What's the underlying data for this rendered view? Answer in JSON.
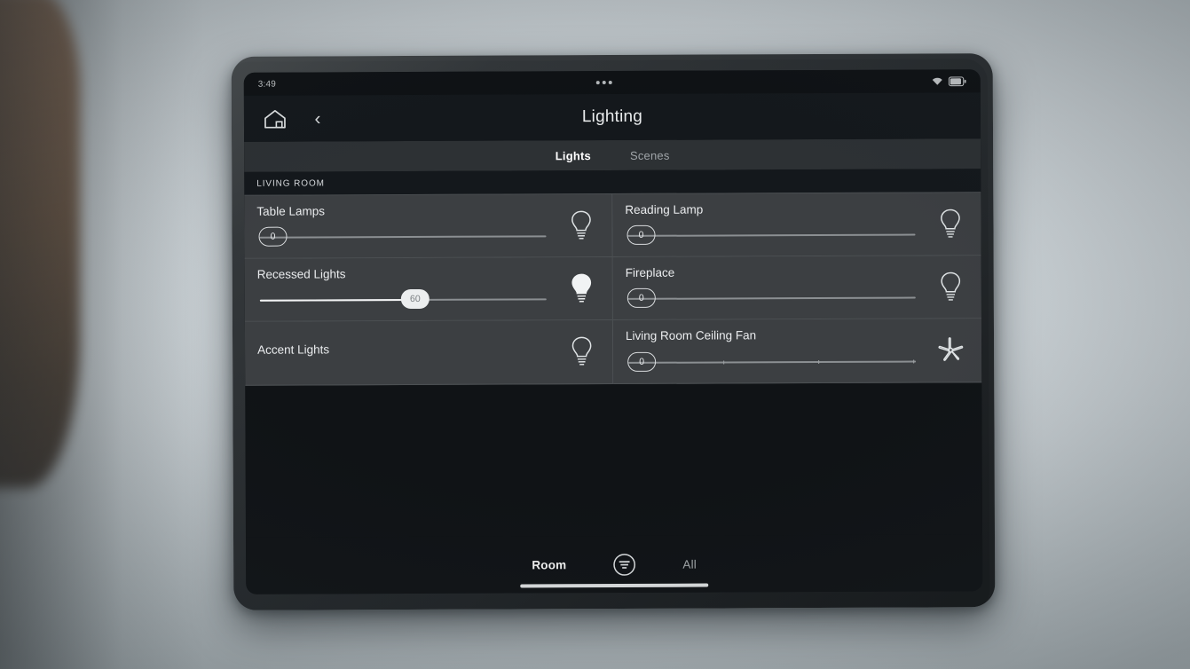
{
  "status_bar": {
    "time": "3:49",
    "center_icon": "more-dots-icon",
    "wifi_icon": "wifi-icon",
    "battery_icon": "battery-icon"
  },
  "header": {
    "home_icon": "home-icon",
    "back_icon": "back-chevron-icon",
    "title": "Lighting"
  },
  "tabs": [
    {
      "label": "Lights",
      "active": true
    },
    {
      "label": "Scenes",
      "active": false
    }
  ],
  "section": {
    "label": "LIVING ROOM"
  },
  "devices": [
    {
      "name": "Table Lamps",
      "has_slider": true,
      "value": "0",
      "value_pct": 0,
      "ticks": false,
      "icon": "bulb-outline-icon",
      "on": false
    },
    {
      "name": "Reading Lamp",
      "has_slider": true,
      "value": "0",
      "value_pct": 0,
      "ticks": false,
      "icon": "bulb-outline-icon",
      "on": false
    },
    {
      "name": "Recessed Lights",
      "has_slider": true,
      "value": "60",
      "value_pct": 60,
      "ticks": false,
      "icon": "bulb-filled-icon",
      "on": true
    },
    {
      "name": "Fireplace",
      "has_slider": true,
      "value": "0",
      "value_pct": 0,
      "ticks": false,
      "icon": "bulb-outline-icon",
      "on": false
    },
    {
      "name": "Accent Lights",
      "has_slider": false,
      "value": "",
      "value_pct": 0,
      "ticks": false,
      "icon": "bulb-outline-icon",
      "on": false
    },
    {
      "name": "Living Room Ceiling Fan",
      "has_slider": true,
      "value": "0",
      "value_pct": 0,
      "ticks": true,
      "icon": "ceiling-fan-icon",
      "on": false
    }
  ],
  "bottom_nav": {
    "left_label": "Room",
    "right_label": "All",
    "filter_icon": "filter-list-icon",
    "active": "Room"
  },
  "colors": {
    "screen_bg": "#101316",
    "card_bg": "#3c3f42",
    "tab_bar_bg": "#2d3134",
    "divider": "#4d5154",
    "text_primary": "#eaecee",
    "text_muted": "#9ea3a7",
    "accent_on": "#f2f3f4"
  }
}
